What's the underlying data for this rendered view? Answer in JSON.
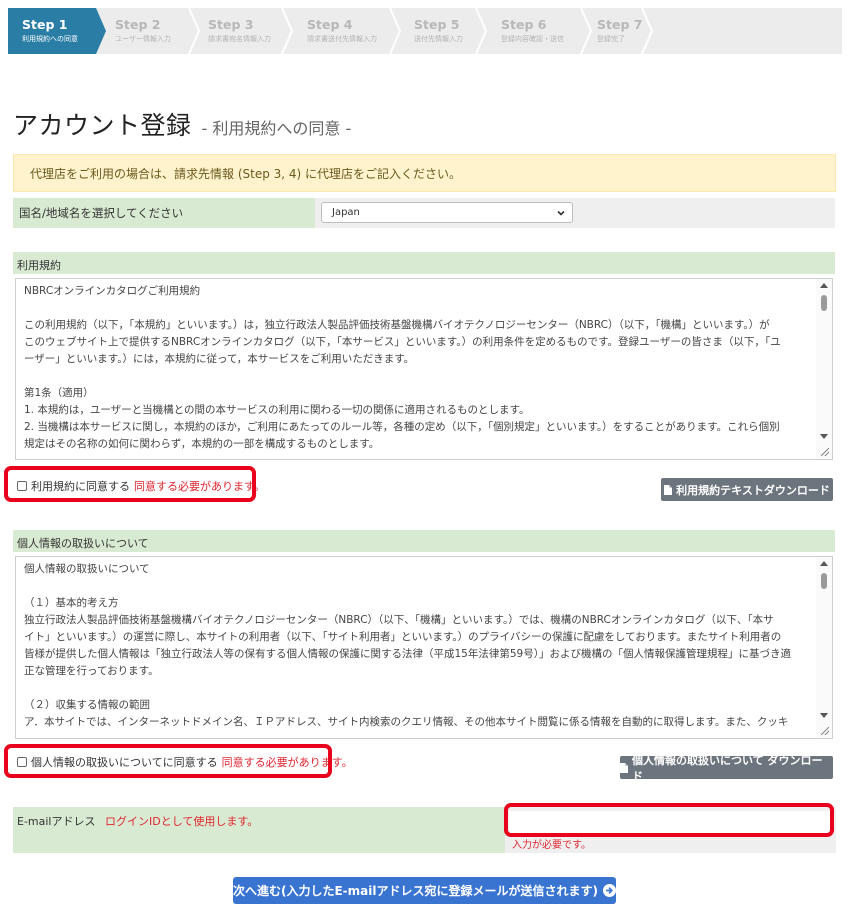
{
  "steps": [
    {
      "num": "Step 1",
      "label": "利用規約への同意",
      "active": true
    },
    {
      "num": "Step 2",
      "label": "ユーザー情報入力",
      "active": false
    },
    {
      "num": "Step 3",
      "label": "請求書宛名情報入力",
      "active": false
    },
    {
      "num": "Step 4",
      "label": "請求書送付先情報入力",
      "active": false
    },
    {
      "num": "Step 5",
      "label": "送付先情報入力",
      "active": false
    },
    {
      "num": "Step 6",
      "label": "登録内容確認・送信",
      "active": false
    },
    {
      "num": "Step 7",
      "label": "登録完了",
      "active": false
    }
  ],
  "page": {
    "title": "アカウント登録",
    "subtitle": "- 利用規約への同意 -"
  },
  "alert": {
    "text": "代理店をご利用の場合は、請求先情報 (Step 3, 4) に代理店をご記入ください。"
  },
  "country": {
    "label": "国名/地域名を選択してください",
    "selected": "Japan"
  },
  "terms": {
    "header": "利用規約",
    "lines": [
      "NBRCオンラインカタログご利用規約",
      "",
      "この利用規約（以下，「本規約」といいます。）は，独立行政法人製品評価技術基盤機構バイオテクノロジーセンター（NBRC）（以下，「機構」といいます。）が",
      "このウェブサイト上で提供するNBRCオンラインカタログ（以下，「本サービス」といいます。）の利用条件を定めるものです。登録ユーザーの皆さま（以下，「ユ",
      "ーザー」といいます。）には，本規約に従って，本サービスをご利用いただきます。",
      "",
      "第1条（適用）",
      "1. 本規約は，ユーザーと当機構との間の本サービスの利用に関わる一切の関係に適用されるものとします。",
      "2. 当機構は本サービスに関し，本規約のほか，ご利用にあたってのルール等，各種の定め（以下，「個別規定」といいます。）をすることがあります。これら個別",
      "規定はその名称の如何に関わらず，本規約の一部を構成するものとします。"
    ],
    "agree_label": "利用規約に同意する",
    "agree_required": "同意する必要があります。",
    "download_label": "利用規約テキストダウンロード"
  },
  "privacy": {
    "header": "個人情報の取扱いについて",
    "lines": [
      "個人情報の取扱いについて",
      "",
      "（１）基本的考え方",
      "独立行政法人製品評価技術基盤機構バイオテクノロジーセンター（NBRC）（以下、「機構」といいます。）では、機構のNBRCオンラインカタログ（以下、「本サ",
      "イト」といいます。）の運営に際し、本サイトの利用者（以下、「サイト利用者」といいます。）のプライバシーの保護に配慮をしております。またサイト利用者の",
      "皆様が提供した個人情報は「独立行政法人等の保有する個人情報の保護に関する法律（平成15年法律第59号）」および機構の「個人情報保護管理規程」に基づき適",
      "正な管理を行っております。",
      "",
      "（２）収集する情報の範囲",
      "ア．本サイトでは、インターネットドメイン名、ＩＰアドレス、サイト内検索のクエリ情報、その他本サイト閲覧に係る情報を自動的に取得します。また、クッキ"
    ],
    "agree_label": "個人情報の取扱いについてに同意する",
    "agree_required": "同意する必要があります。",
    "download_label": "個人情報の取扱いについて ダウンロード"
  },
  "email": {
    "label": "E-mailアドレス",
    "note": "ログインIDとして使用します。",
    "value": "",
    "error": "入力が必要です。"
  },
  "next_button": {
    "label": "次へ進む(入力したE-mailアドレス宛に登録メールが送信されます)"
  },
  "colors": {
    "step_active": "#2a7ea6",
    "section_bg": "#d9ead3",
    "alert_bg": "#fff3cd",
    "required_red": "#e0262f",
    "highlight_red": "#e8001c",
    "primary_button": "#3a74d1",
    "secondary_button": "#6c757d"
  }
}
